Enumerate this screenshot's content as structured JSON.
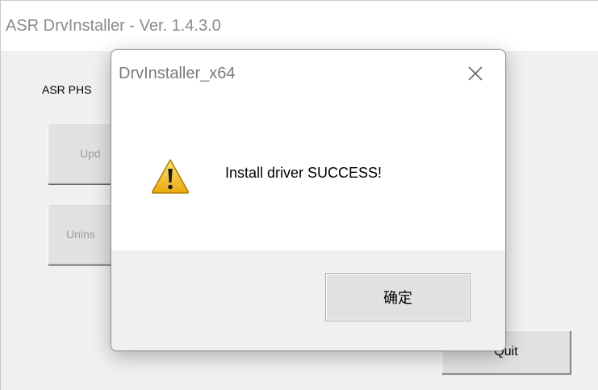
{
  "main_window": {
    "title": "ASR DrvInstaller - Ver. 1.4.3.0",
    "group_label": "ASR PHS",
    "update_button_label": "Upd",
    "uninstall_button_label": "Unins",
    "quit_button_label": "Quit"
  },
  "dialog": {
    "title": "DrvInstaller_x64",
    "message": "Install driver SUCCESS!",
    "ok_button_label": "确定",
    "icon": "warning-icon",
    "close_icon": "close-icon"
  },
  "colors": {
    "warning_yellow": "#f4c430",
    "dialog_footer": "#f0f0f0",
    "main_background": "#f0f0f0"
  }
}
